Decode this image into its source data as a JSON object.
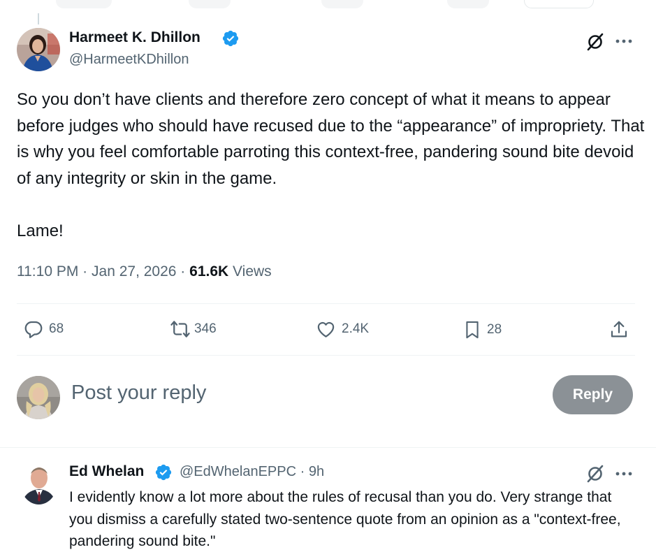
{
  "tweet": {
    "author": {
      "name": "Harmeet K. Dhillon",
      "handle": "@HarmeetKDhillon",
      "verified": true
    },
    "text": [
      "So you don’t have clients and therefore zero concept of what it means to appear before judges who should have recused due to the “appearance” of impropriety. That is why you feel comfortable parroting this context-free, pandering sound bite devoid of any integrity or skin in the game.",
      "Lame!"
    ],
    "time": "11:10 PM",
    "date": "Jan 27, 2026",
    "separator": "·",
    "views_count": "61.6K",
    "views_label": "Views",
    "actions": {
      "replies": "68",
      "reposts": "346",
      "likes": "2.4K",
      "bookmarks": "28"
    }
  },
  "composer": {
    "placeholder": "Post your reply",
    "button_label": "Reply"
  },
  "reply": {
    "author": {
      "name": "Ed Whelan",
      "handle": "@EdWhelanEPPC",
      "verified": true
    },
    "separator": "·",
    "time_ago": "9h",
    "text": "I evidently know a lot more about the rules of recusal than you do. Very strange that you dismiss a carefully stated two-sentence quote from an opinion as a \"context-free, pandering sound bite.\""
  },
  "icons": {
    "verified": "verified-badge-icon",
    "grok": "grok-icon",
    "more": "more-icon",
    "reply": "reply-icon",
    "repost": "repost-icon",
    "like": "like-icon",
    "bookmark": "bookmark-icon",
    "share": "share-icon"
  },
  "colors": {
    "verified": "#1d9bf0",
    "text": "#0f1419",
    "secondary": "#536471",
    "reply_button_disabled": "#8b9196",
    "divider": "#eff3f4"
  }
}
